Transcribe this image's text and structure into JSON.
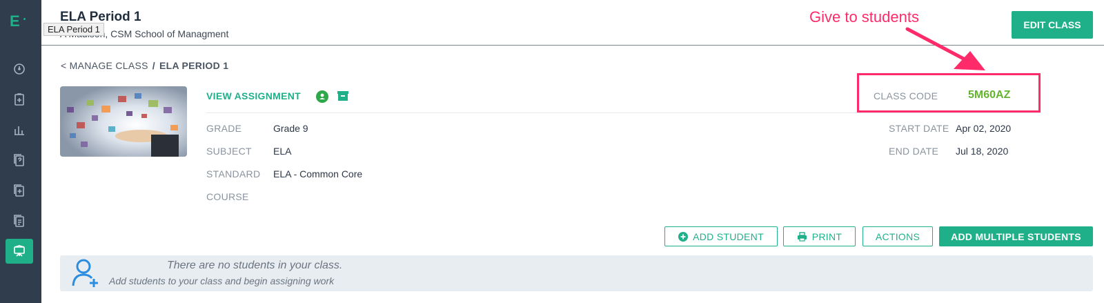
{
  "sidebar": {
    "logo": "E",
    "items": [
      {
        "name": "dashboard"
      },
      {
        "name": "clipboard-add"
      },
      {
        "name": "reports"
      },
      {
        "name": "question-bank"
      },
      {
        "name": "assessment-add"
      },
      {
        "name": "documents"
      },
      {
        "name": "manage-class",
        "active": true
      }
    ]
  },
  "header": {
    "title": "ELA Period 1",
    "subtitle": "A Madison, CSM School of Managment",
    "tooltip": "ELA Period 1",
    "edit_button": "EDIT CLASS"
  },
  "annotation": {
    "text": "Give to students",
    "color": "#ff2a6a"
  },
  "breadcrumb": {
    "back": "< MANAGE CLASS",
    "separator": "/",
    "current": "ELA PERIOD 1"
  },
  "details": {
    "view_assignment": "VIEW ASSIGNMENT",
    "grade_label": "GRADE",
    "grade_value": "Grade 9",
    "subject_label": "SUBJECT",
    "subject_value": "ELA",
    "standard_label": "STANDARD",
    "standard_value": "ELA - Common Core",
    "course_label": "COURSE",
    "course_value": "",
    "class_code_label": "CLASS CODE",
    "class_code_value": "5M60AZ",
    "start_date_label": "START DATE",
    "start_date_value": "Apr 02, 2020",
    "end_date_label": "END DATE",
    "end_date_value": "Jul 18, 2020"
  },
  "actions": {
    "add_student": "ADD STUDENT",
    "print": "PRINT",
    "actions": "ACTIONS",
    "add_multiple": "ADD MULTIPLE STUDENTS"
  },
  "empty_state": {
    "title": "There are no students in your class.",
    "subtitle": "Add students to your class and begin assigning work"
  },
  "colors": {
    "accent": "#1fb08a",
    "sidebar": "#2f3d4c",
    "code": "#63b42d"
  }
}
